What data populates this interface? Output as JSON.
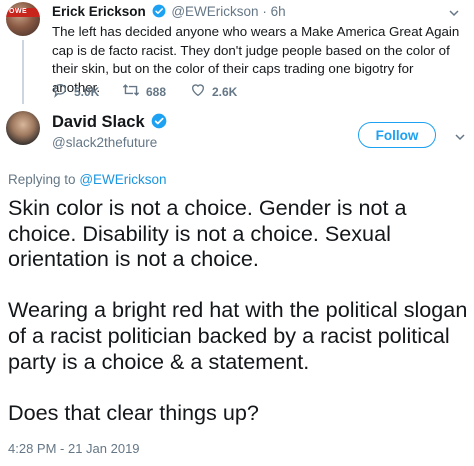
{
  "parent_tweet": {
    "avatar_banner_text": "OWE",
    "display_name": "Erick Erickson",
    "handle": "@EWErickson",
    "separator": "·",
    "time": "6h",
    "text": "The left has decided anyone who wears a Make America Great Again cap is de facto racist. They don't judge people based on the color of their skin, but on the color of their caps trading one bigotry for another.",
    "reply_count": "5.0K",
    "retweet_count": "688",
    "like_count": "2.6K"
  },
  "main_tweet": {
    "display_name": "David Slack",
    "handle": "@slack2thefuture",
    "follow_label": "Follow",
    "replying_prefix": "Replying to",
    "replying_to": "@EWErickson",
    "paragraphs": [
      "Skin color is not a choice. Gender is not a choice. Disability is not a choice. Sexual orientation is not a choice.",
      "Wearing a bright red hat with the political slogan of a racist politician backed by a racist political party is a choice & a statement.",
      "Does that clear things up?"
    ],
    "timestamp": "4:28 PM - 21 Jan 2019"
  },
  "icons": {
    "verified": "verified-badge-icon",
    "reply": "reply-icon",
    "retweet": "retweet-icon",
    "like": "heart-icon",
    "menu": "chevron-down-icon"
  },
  "colors": {
    "accent": "#1da1f2",
    "link": "#1b95e0",
    "muted": "#657786",
    "text": "#14171a"
  }
}
